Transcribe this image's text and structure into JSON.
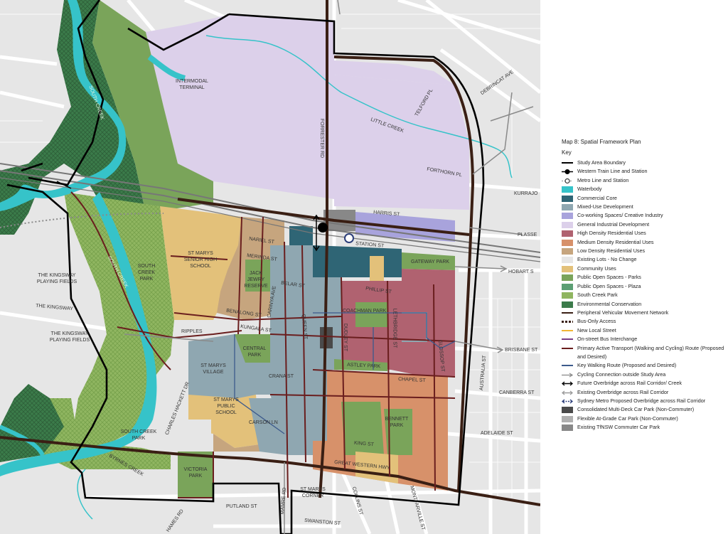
{
  "map_title": "Map 8: Spatial Framework Plan",
  "legend_heading": "Key",
  "legend": [
    {
      "label": "Study Area Boundary",
      "kind": "line",
      "color": "#000000"
    },
    {
      "label": "Western Train Line and Station",
      "kind": "train",
      "color": "#000000"
    },
    {
      "label": "Metro Line and Station",
      "kind": "metro",
      "color": "#8a8a8a"
    },
    {
      "label": "Waterbody",
      "kind": "fill",
      "color": "#36c3c9"
    },
    {
      "label": "Commercial Core",
      "kind": "fill",
      "color": "#2f6575"
    },
    {
      "label": "Mixed-Use Development",
      "kind": "fill",
      "color": "#8fa7b1"
    },
    {
      "label": "Co-working Spaces/ Creative Industry",
      "kind": "fill",
      "color": "#a8a3dc"
    },
    {
      "label": "General Industrial Development",
      "kind": "fill",
      "color": "#dcd0ea"
    },
    {
      "label": "High Density Residential Uses",
      "kind": "fill",
      "color": "#b06270"
    },
    {
      "label": "Medium Density Residential Uses",
      "kind": "fill",
      "color": "#d7916a"
    },
    {
      "label": "Low Density Residential Uses",
      "kind": "fill",
      "color": "#c6a57e"
    },
    {
      "label": "Existing Lots - No Change",
      "kind": "fill",
      "color": "#e6e6e6"
    },
    {
      "label": "Community Uses",
      "kind": "fill",
      "color": "#e3c17a"
    },
    {
      "label": "Public Open Spaces - Parks",
      "kind": "fill",
      "color": "#7aa45a"
    },
    {
      "label": "Public Open Spaces - Plaza",
      "kind": "fill",
      "color": "#5c9f74"
    },
    {
      "label": "South Creek Park",
      "kind": "fill",
      "color": "#8fb560"
    },
    {
      "label": "Environmental Conservation",
      "kind": "fill",
      "color": "#3b7b4a"
    },
    {
      "label": "Peripheral Vehicular Movement Network",
      "kind": "line",
      "color": "#3a1f14"
    },
    {
      "label": "Bus-Only Access",
      "kind": "dash",
      "color": "#3a1f14"
    },
    {
      "label": "New Local Street",
      "kind": "line",
      "color": "#f2b535"
    },
    {
      "label": "On-street Bus Interchange",
      "kind": "line",
      "color": "#7a3d86"
    },
    {
      "label": "Primary Active Transport (Walking and Cycling) Route (Proposed and Desired)",
      "kind": "line",
      "color": "#6a1e1e"
    },
    {
      "label": "Key Walking Route (Proposed and Desired)",
      "kind": "line",
      "color": "#3c5a8c"
    },
    {
      "label": "Cycling Connection outside Study Area",
      "kind": "arrow",
      "color": "#8a8a8a"
    },
    {
      "label": "Future Overbridge across Rail Corridor/ Creek",
      "kind": "darrow",
      "color": "#000000"
    },
    {
      "label": "Existing Overbridge across Rail Corridor",
      "kind": "darrow",
      "color": "#9a9a9a"
    },
    {
      "label": "Sydney Metro Proposed Overbridge across Rail Corridor",
      "kind": "ddarrow",
      "color": "#2c3e7a"
    },
    {
      "label": "Consolidated Multi-Deck Car Park (Non-Commuter)",
      "kind": "fill",
      "color": "#4a4a4a"
    },
    {
      "label": "Flexible At-Grade Car Park (Non-Commuter)",
      "kind": "fill",
      "color": "#b0b0b0"
    },
    {
      "label": "Existing TfNSW Commuter Car Park",
      "kind": "fill",
      "color": "#888888"
    }
  ],
  "map_labels": {
    "intermodal_terminal": "INTERMODAL TERMINAL",
    "little_creek": "LITTLE CREEK",
    "telford_pl": "TELFORD PL",
    "debrincat_ave": "DEBRINCAT AVE",
    "forthorn_pl": "FORTHORN PL",
    "kurrajong": "KURRAJO",
    "plassey": "PLASSE",
    "harris_st": "HARRIS ST",
    "station_st": "STATION ST",
    "gateway_park": "GATEWAY PARK",
    "hobart_st": "HOBART S",
    "forrester_rd": "FORRESTER RD",
    "south_creek": "SOUTH CREEK",
    "south_creek_2": "SOUTH CREEK",
    "kingsway_fields_1": "THE KINGSWAY PLAYING FIELDS",
    "kingsway_fields_2": "THE KINGSWAY PLAYING FIELDS",
    "the_kingsway": "THE KINGSWAY",
    "south_creek_park": "SOUTH CREEK PARK",
    "south_creek_park_2": "SOUTH CREEK PARK",
    "senior_high": "ST MARYS SENIOR HIGH SCHOOL",
    "nariel_st": "NARIEL ST",
    "merinda_st": "MERINDA ST",
    "jack_jewry": "JACK JEWRY RESERVE",
    "belar_st": "BELAR ST",
    "benalong_st": "BENALONG ST",
    "carinya_ave": "CARINYA AVE",
    "ripples": "RIPPLES",
    "kungala_st": "KUNGALA ST",
    "queen_st": "QUEEN ST",
    "phillip_st": "PHILLIP ST",
    "coachman_park": "COACHMAN PARK",
    "lethbridge_st": "LETHBRIDGE ST",
    "dudley_st": "DUDLEY ST",
    "glossop_st": "GLOSSOP ST",
    "brisbane_st": "BRISBANE ST",
    "central_park": "CENTRAL PARK",
    "st_marys_village": "ST MARYS VILLAGE",
    "astley_park": "ASTLEY PARK",
    "chapel_st": "CHAPEL ST",
    "crana_st": "CRANA ST",
    "australia_st": "AUSTRALIA ST",
    "canberra_st": "CANBERRA ST",
    "public_school": "ST MARYS PUBLIC SCHOOL",
    "charles_hackett": "CHARLES HACKETT DR",
    "carson_ln": "CARSON LN",
    "bennett_park": "BENNETT PARK",
    "adelaide_st": "ADELAIDE ST",
    "king_st": "KING ST",
    "great_western_hwy": "GREAT WESTERN HWY",
    "byrnes_creek": "BYRNES CREEK",
    "victoria_park": "VICTORIA PARK",
    "mamre_rd": "MAMRE RD",
    "st_marys_corner": "ST MARYS CORNER",
    "collins_st": "COLLINS ST",
    "montfarville_st": "MONTFARVILLE ST",
    "putland_st": "PUTLAND ST",
    "swanston_st": "SWANSTON ST",
    "hames_rd": "HAMES RD"
  },
  "colors": {
    "background": "#e9e9e9",
    "road": "#ffffff",
    "boundary": "#000000",
    "peripheral": "#3a1f14",
    "active": "#6a1e1e"
  }
}
